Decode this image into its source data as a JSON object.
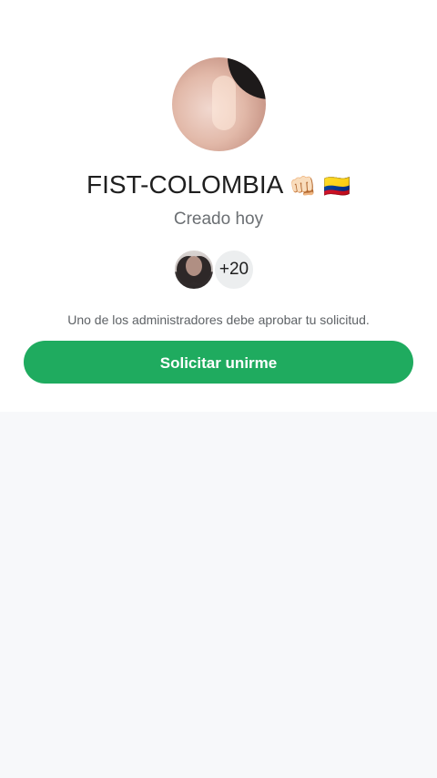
{
  "group": {
    "name": "FIST-COLOMBIA",
    "emojis": "👊🏻 🇨🇴",
    "created": "Creado hoy",
    "member_count": "+20"
  },
  "notice": "Uno de los administradores debe aprobar tu solicitud.",
  "actions": {
    "join_label": "Solicitar unirme"
  },
  "colors": {
    "accent": "#1fab5f",
    "background": "#f7f8fa",
    "card": "#ffffff"
  }
}
